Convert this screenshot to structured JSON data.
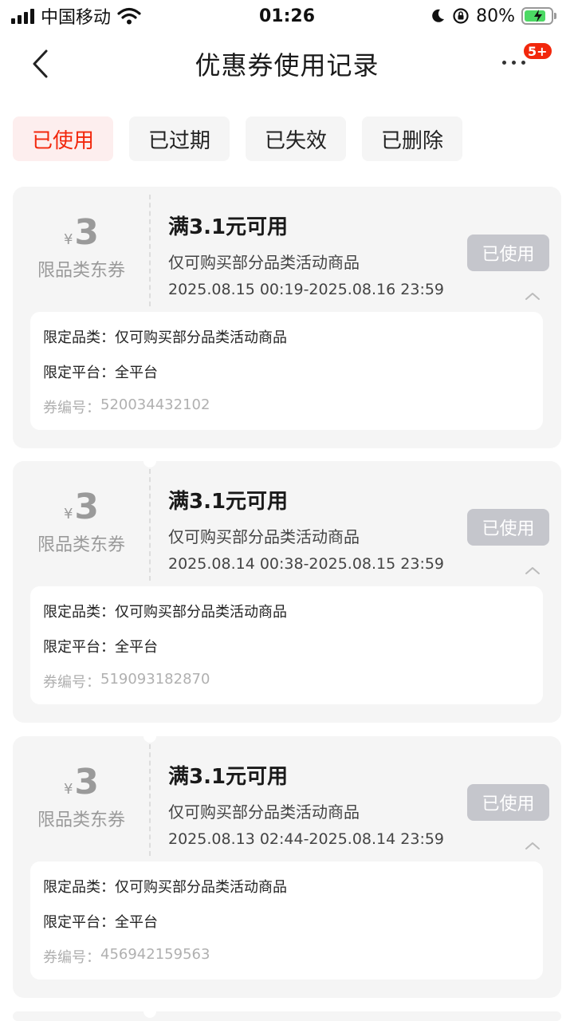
{
  "status_bar": {
    "carrier": "中国移动",
    "time": "01:26",
    "battery_percent": "80%",
    "battery_level": 0.8,
    "icons": [
      "signal-icon",
      "wifi-icon",
      "moon-icon",
      "orientation-lock-icon",
      "battery-charging-icon"
    ]
  },
  "nav": {
    "title": "优惠券使用记录",
    "badge": "5+",
    "icons": [
      "back-icon",
      "more-icon"
    ]
  },
  "tabs": [
    {
      "label": "已使用",
      "active": true
    },
    {
      "label": "已过期",
      "active": false
    },
    {
      "label": "已失效",
      "active": false
    },
    {
      "label": "已删除",
      "active": false
    }
  ],
  "coupons": [
    {
      "currency": "¥",
      "amount": "3",
      "type": "限品类东券",
      "condition": "满3.1元可用",
      "scope": "仅可购买部分品类活动商品",
      "validity": "2025.08.15 00:19-2025.08.16 23:59",
      "status_label": "已使用",
      "category_label": "限定品类：",
      "category_value": "仅可购买部分品类活动商品",
      "platform_label": "限定平台：",
      "platform_value": "全平台",
      "code_label": "券编号：",
      "code_value": "520034432102"
    },
    {
      "currency": "¥",
      "amount": "3",
      "type": "限品类东券",
      "condition": "满3.1元可用",
      "scope": "仅可购买部分品类活动商品",
      "validity": "2025.08.14 00:38-2025.08.15 23:59",
      "status_label": "已使用",
      "category_label": "限定品类：",
      "category_value": "仅可购买部分品类活动商品",
      "platform_label": "限定平台：",
      "platform_value": "全平台",
      "code_label": "券编号：",
      "code_value": "519093182870"
    },
    {
      "currency": "¥",
      "amount": "3",
      "type": "限品类东券",
      "condition": "满3.1元可用",
      "scope": "仅可购买部分品类活动商品",
      "validity": "2025.08.13 02:44-2025.08.14 23:59",
      "status_label": "已使用",
      "category_label": "限定品类：",
      "category_value": "仅可购买部分品类活动商品",
      "platform_label": "限定平台：",
      "platform_value": "全平台",
      "code_label": "券编号：",
      "code_value": "456942159563"
    }
  ],
  "colors": {
    "accent": "#f2270c",
    "tab_active_bg": "#fdeeee",
    "card_bg": "#f5f5f5",
    "used_button_bg": "#c5c6cc"
  }
}
